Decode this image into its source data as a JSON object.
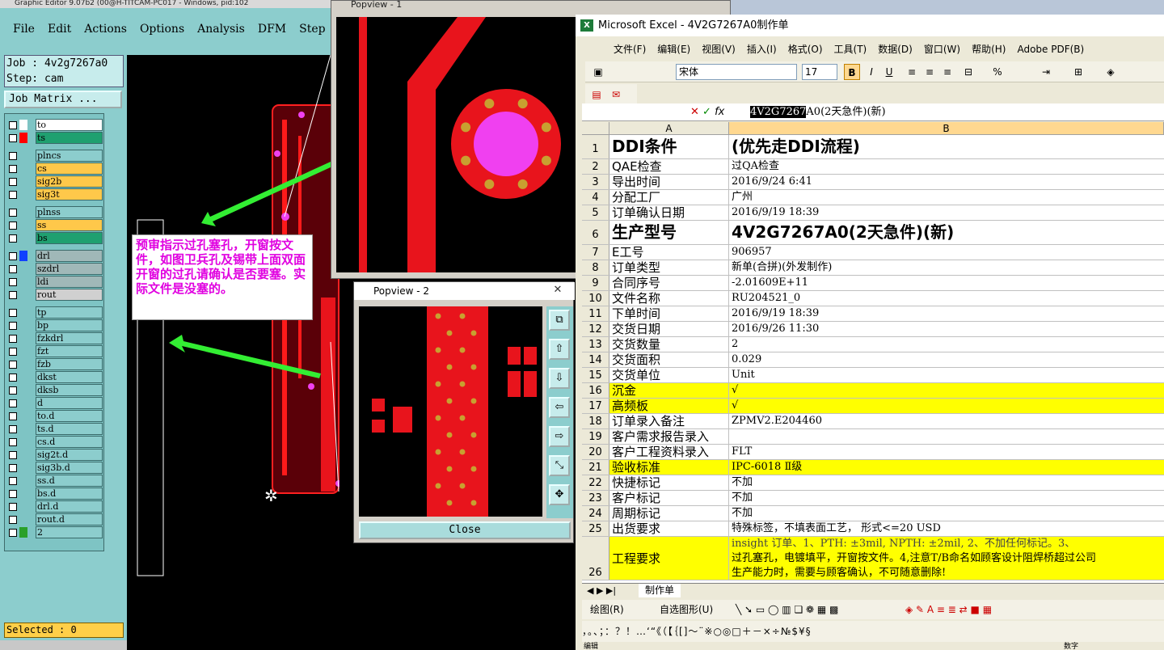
{
  "ge": {
    "title": "Graphic Editor 9.07b2 (00@H-TITCAM-PC017 - Windows, pid:102",
    "menu": [
      "File",
      "Edit",
      "Actions",
      "Options",
      "Analysis",
      "DFM",
      "Step",
      "Ro"
    ],
    "job_line": "Job : 4v2g7267a0",
    "step_line": "Step: cam",
    "job_matrix": "Job Matrix ...",
    "layers": [
      {
        "name": "to",
        "swatch": "#ffffff",
        "bg": "#ffffff"
      },
      {
        "name": "ts",
        "swatch": "#ff0000",
        "bg": "#1fa070"
      },
      {
        "name": "plncs",
        "swatch": "",
        "bg": "#8ccdcd"
      },
      {
        "name": "cs",
        "swatch": "",
        "bg": "#ffc84a"
      },
      {
        "name": "sig2b",
        "swatch": "",
        "bg": "#ffc84a"
      },
      {
        "name": "sig3t",
        "swatch": "",
        "bg": "#ffc84a"
      },
      {
        "name": "plnss",
        "swatch": "",
        "bg": "#8ccdcd"
      },
      {
        "name": "ss",
        "swatch": "",
        "bg": "#ffc84a"
      },
      {
        "name": "bs",
        "swatch": "",
        "bg": "#1fa070"
      },
      {
        "name": "drl",
        "swatch": "#1040ff",
        "bg": "#a0b8b8"
      },
      {
        "name": "szdrl",
        "swatch": "",
        "bg": "#a0b8b8"
      },
      {
        "name": "ldi",
        "swatch": "",
        "bg": "#a0b8b8"
      },
      {
        "name": "rout",
        "swatch": "",
        "bg": "#d0d0d0"
      },
      {
        "name": "tp",
        "swatch": "",
        "bg": "#8ccdcd"
      },
      {
        "name": "bp",
        "swatch": "",
        "bg": "#8ccdcd"
      },
      {
        "name": "fzkdrl",
        "swatch": "",
        "bg": "#8ccdcd"
      },
      {
        "name": "fzt",
        "swatch": "",
        "bg": "#8ccdcd"
      },
      {
        "name": "fzb",
        "swatch": "",
        "bg": "#8ccdcd"
      },
      {
        "name": "dkst",
        "swatch": "",
        "bg": "#8ccdcd"
      },
      {
        "name": "dksb",
        "swatch": "",
        "bg": "#8ccdcd"
      },
      {
        "name": "d",
        "swatch": "",
        "bg": "#8ccdcd"
      },
      {
        "name": "to.d",
        "swatch": "",
        "bg": "#8ccdcd"
      },
      {
        "name": "ts.d",
        "swatch": "",
        "bg": "#8ccdcd"
      },
      {
        "name": "cs.d",
        "swatch": "",
        "bg": "#8ccdcd"
      },
      {
        "name": "sig2t.d",
        "swatch": "",
        "bg": "#8ccdcd"
      },
      {
        "name": "sig3b.d",
        "swatch": "",
        "bg": "#8ccdcd"
      },
      {
        "name": "ss.d",
        "swatch": "",
        "bg": "#8ccdcd"
      },
      {
        "name": "bs.d",
        "swatch": "",
        "bg": "#8ccdcd"
      },
      {
        "name": "drl.d",
        "swatch": "",
        "bg": "#8ccdcd"
      },
      {
        "name": "rout.d",
        "swatch": "",
        "bg": "#8ccdcd"
      },
      {
        "name": "2",
        "swatch": "#2aa02a",
        "bg": "#8ccdcd"
      }
    ],
    "selected": "Selected : 0"
  },
  "popview1": {
    "title": "Popview - 1"
  },
  "popview2": {
    "title": "Popview - 2",
    "close_label": "Close",
    "x_glyph": "✕"
  },
  "note": "预审指示过孔塞孔，开窗按文件，如图卫兵孔及锡带上面双面开窗的过孔请确认是否要塞。实际文件是没塞的。",
  "excel": {
    "title": "Microsoft Excel - 4V2G7267A0制作单",
    "menu": [
      "文件(F)",
      "编辑(E)",
      "视图(V)",
      "插入(I)",
      "格式(O)",
      "工具(T)",
      "数据(D)",
      "窗口(W)",
      "帮助(H)",
      "Adobe PDF(B)"
    ],
    "font_name": "宋体",
    "font_size": "17",
    "formula_highlight": "4V2G7267",
    "formula_rest": "A0(2天急件)(新)",
    "col_a": "A",
    "col_b": "B",
    "rows": [
      {
        "n": "1",
        "a": "DDI条件",
        "b": "(优先走DDI流程)",
        "big": true,
        "yel": false,
        "h": 30
      },
      {
        "n": "2",
        "a": "QAE检查",
        "b": "过QA检查",
        "big": false,
        "yel": false,
        "h": 19
      },
      {
        "n": "3",
        "a": "导出时间",
        "b": "2016/9/24 6:41",
        "big": false,
        "yel": false,
        "h": 19
      },
      {
        "n": "4",
        "a": "分配工厂",
        "b": "广州",
        "big": false,
        "yel": false,
        "h": 19
      },
      {
        "n": "5",
        "a": "订单确认日期",
        "b": "2016/9/19 18:39",
        "big": false,
        "yel": false,
        "h": 19
      },
      {
        "n": "6",
        "a": "生产型号",
        "b": "4V2G7267A0(2天急件)(新)",
        "big": true,
        "yel": false,
        "h": 30
      },
      {
        "n": "7",
        "a": "E工号",
        "b": "906957",
        "big": false,
        "yel": false,
        "h": 19
      },
      {
        "n": "8",
        "a": "订单类型",
        "b": "新单(合拼)(外发制作)",
        "big": false,
        "yel": false,
        "h": 19
      },
      {
        "n": "9",
        "a": "合同序号",
        "b": "-2.01609E+11",
        "big": false,
        "yel": false,
        "h": 19
      },
      {
        "n": "10",
        "a": "文件名称",
        "b": "RU204521_0",
        "big": false,
        "yel": false,
        "h": 19
      },
      {
        "n": "11",
        "a": "下单时间",
        "b": "2016/9/19 18:39",
        "big": false,
        "yel": false,
        "h": 19
      },
      {
        "n": "12",
        "a": "交货日期",
        "b": "2016/9/26 11:30",
        "big": false,
        "yel": false,
        "h": 19
      },
      {
        "n": "13",
        "a": "交货数量",
        "b": "2",
        "big": false,
        "yel": false,
        "h": 19
      },
      {
        "n": "14",
        "a": "交货面积",
        "b": "0.029",
        "big": false,
        "yel": false,
        "h": 19
      },
      {
        "n": "15",
        "a": "交货单位",
        "b": "Unit",
        "big": false,
        "yel": false,
        "h": 19
      },
      {
        "n": "16",
        "a": "沉金",
        "b": "√",
        "big": false,
        "yel": true,
        "h": 19
      },
      {
        "n": "17",
        "a": "高频板",
        "b": "√",
        "big": false,
        "yel": true,
        "h": 19
      },
      {
        "n": "18",
        "a": "订单录入备注",
        "b": "ZPMV2.E204460",
        "big": false,
        "yel": false,
        "h": 19
      },
      {
        "n": "19",
        "a": "客户需求报告录入",
        "b": "",
        "big": false,
        "yel": false,
        "h": 19
      },
      {
        "n": "20",
        "a": "客户工程资料录入",
        "b": "FLT",
        "big": false,
        "yel": false,
        "h": 19
      },
      {
        "n": "21",
        "a": "验收标准",
        "b": "IPC-6018 Ⅱ级",
        "big": false,
        "yel": true,
        "h": 19
      },
      {
        "n": "22",
        "a": "快捷标记",
        "b": "不加",
        "big": false,
        "yel": false,
        "h": 19
      },
      {
        "n": "23",
        "a": "客户标记",
        "b": "不加",
        "big": false,
        "yel": false,
        "h": 19
      },
      {
        "n": "24",
        "a": "周期标记",
        "b": "不加",
        "big": false,
        "yel": false,
        "h": 19
      },
      {
        "n": "25",
        "a": "出货要求",
        "b": "特殊标签，不填表面工艺， 形式<=20 USD",
        "big": false,
        "yel": false,
        "h": 19
      }
    ],
    "row26": {
      "n": "26",
      "a": "工程要求",
      "b1": "insight 订单、1、PTH: ±3mil,   NPTH: ±2mil,   2、不加任何标记。3、",
      "b2": "过孔塞孔，电镀填平，开窗按文件。4,注意T/B命名如顾客设计阻焊桥超过公司",
      "b3": "生产能力时，需要与顾客确认，不可随意删除!"
    },
    "sheet_tab": "制作单",
    "draw_label": "绘图(R)",
    "autoshape_label": "自选图形(U)",
    "symbols": "，。、；：？！…‘“《（【｛[]～¨※○◎□＋－×÷№$¥§",
    "status": "编辑",
    "status_right": "数字"
  },
  "colors": {
    "accent_red": "#e00000",
    "note_text": "#e000e0",
    "arrow": "#33ee33",
    "pcb_red": "#e8141c",
    "pad_gold": "#c8a030",
    "pad_magenta": "#f040f0"
  }
}
